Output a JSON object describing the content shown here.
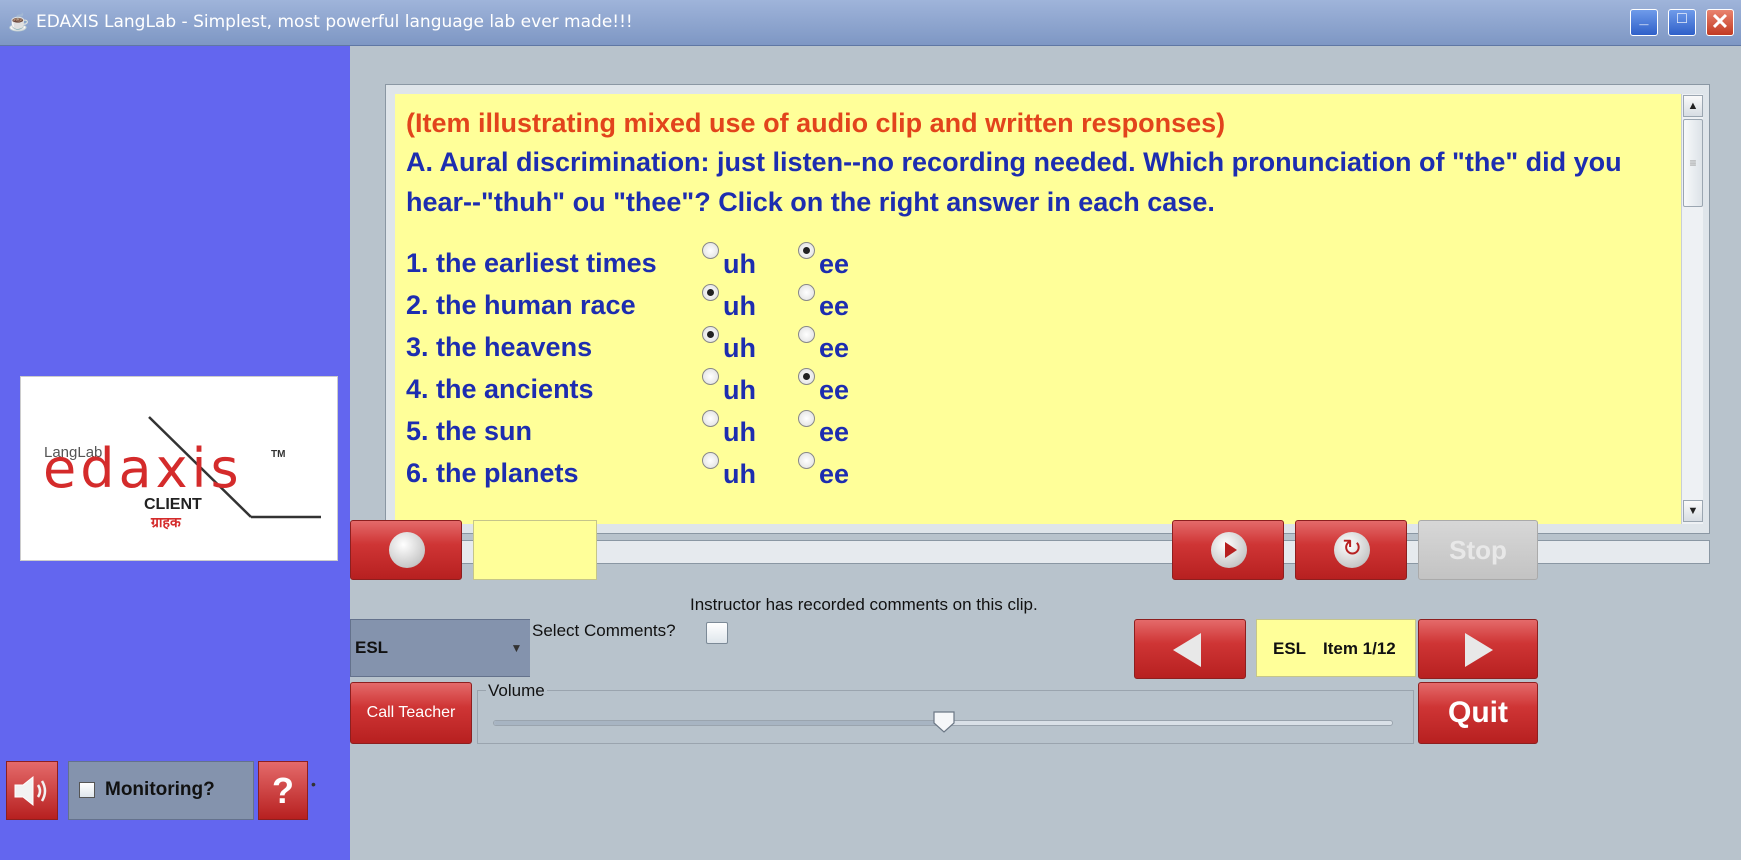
{
  "window": {
    "title": "EDAXIS LangLab - Simplest, most powerful language lab ever made!!!",
    "icon": "java-cup-icon",
    "controls": {
      "minimize": "_",
      "close": "✕"
    }
  },
  "logo": {
    "brand_small": "LangLab",
    "brand": "edaxis",
    "trademark": "TM",
    "client_label": "CLIENT",
    "client_label_hindi": "ग्राहक"
  },
  "content": {
    "heading": "(Item illustrating mixed use of audio clip and written responses)",
    "instructions": "A. Aural discrimination: just listen--no recording needed. Which pronunciation of \"the\" did you hear--\"thuh\" ou \"thee\"? Click on the right answer in each case.",
    "items": [
      {
        "label": "1. the earliest times",
        "opt1": "uh",
        "opt2": "ee",
        "selected": "ee"
      },
      {
        "label": "2. the human race",
        "opt1": "uh",
        "opt2": "ee",
        "selected": "uh"
      },
      {
        "label": "3. the heavens",
        "opt1": "uh",
        "opt2": "ee",
        "selected": "uh"
      },
      {
        "label": "4. the ancients",
        "opt1": "uh",
        "opt2": "ee",
        "selected": "ee"
      },
      {
        "label": "5. the sun",
        "opt1": "uh",
        "opt2": "ee",
        "selected": null
      },
      {
        "label": "6. the planets",
        "opt1": "uh",
        "opt2": "ee",
        "selected": null
      }
    ]
  },
  "controls": {
    "stop_label": "Stop",
    "instructor_note": "Instructor has recorded comments on this clip.",
    "course_select_value": "ESL",
    "select_comments_label": "Select Comments?",
    "select_comments_checked": false,
    "item_course": "ESL",
    "item_counter": "Item 1/12",
    "call_teacher_label": "Call Teacher",
    "volume_label": "Volume",
    "volume_level": 0.5,
    "quit_label": "Quit"
  },
  "sidebar": {
    "monitoring_label": "Monitoring?",
    "monitoring_checked": false,
    "help_label": "?"
  },
  "colors": {
    "sidebar": "#6366ef",
    "content_bg": "#ffff99",
    "heading": "#e2441c",
    "text": "#1d2db0",
    "button_red": "#cf3535",
    "background": "#b8c3cc"
  }
}
